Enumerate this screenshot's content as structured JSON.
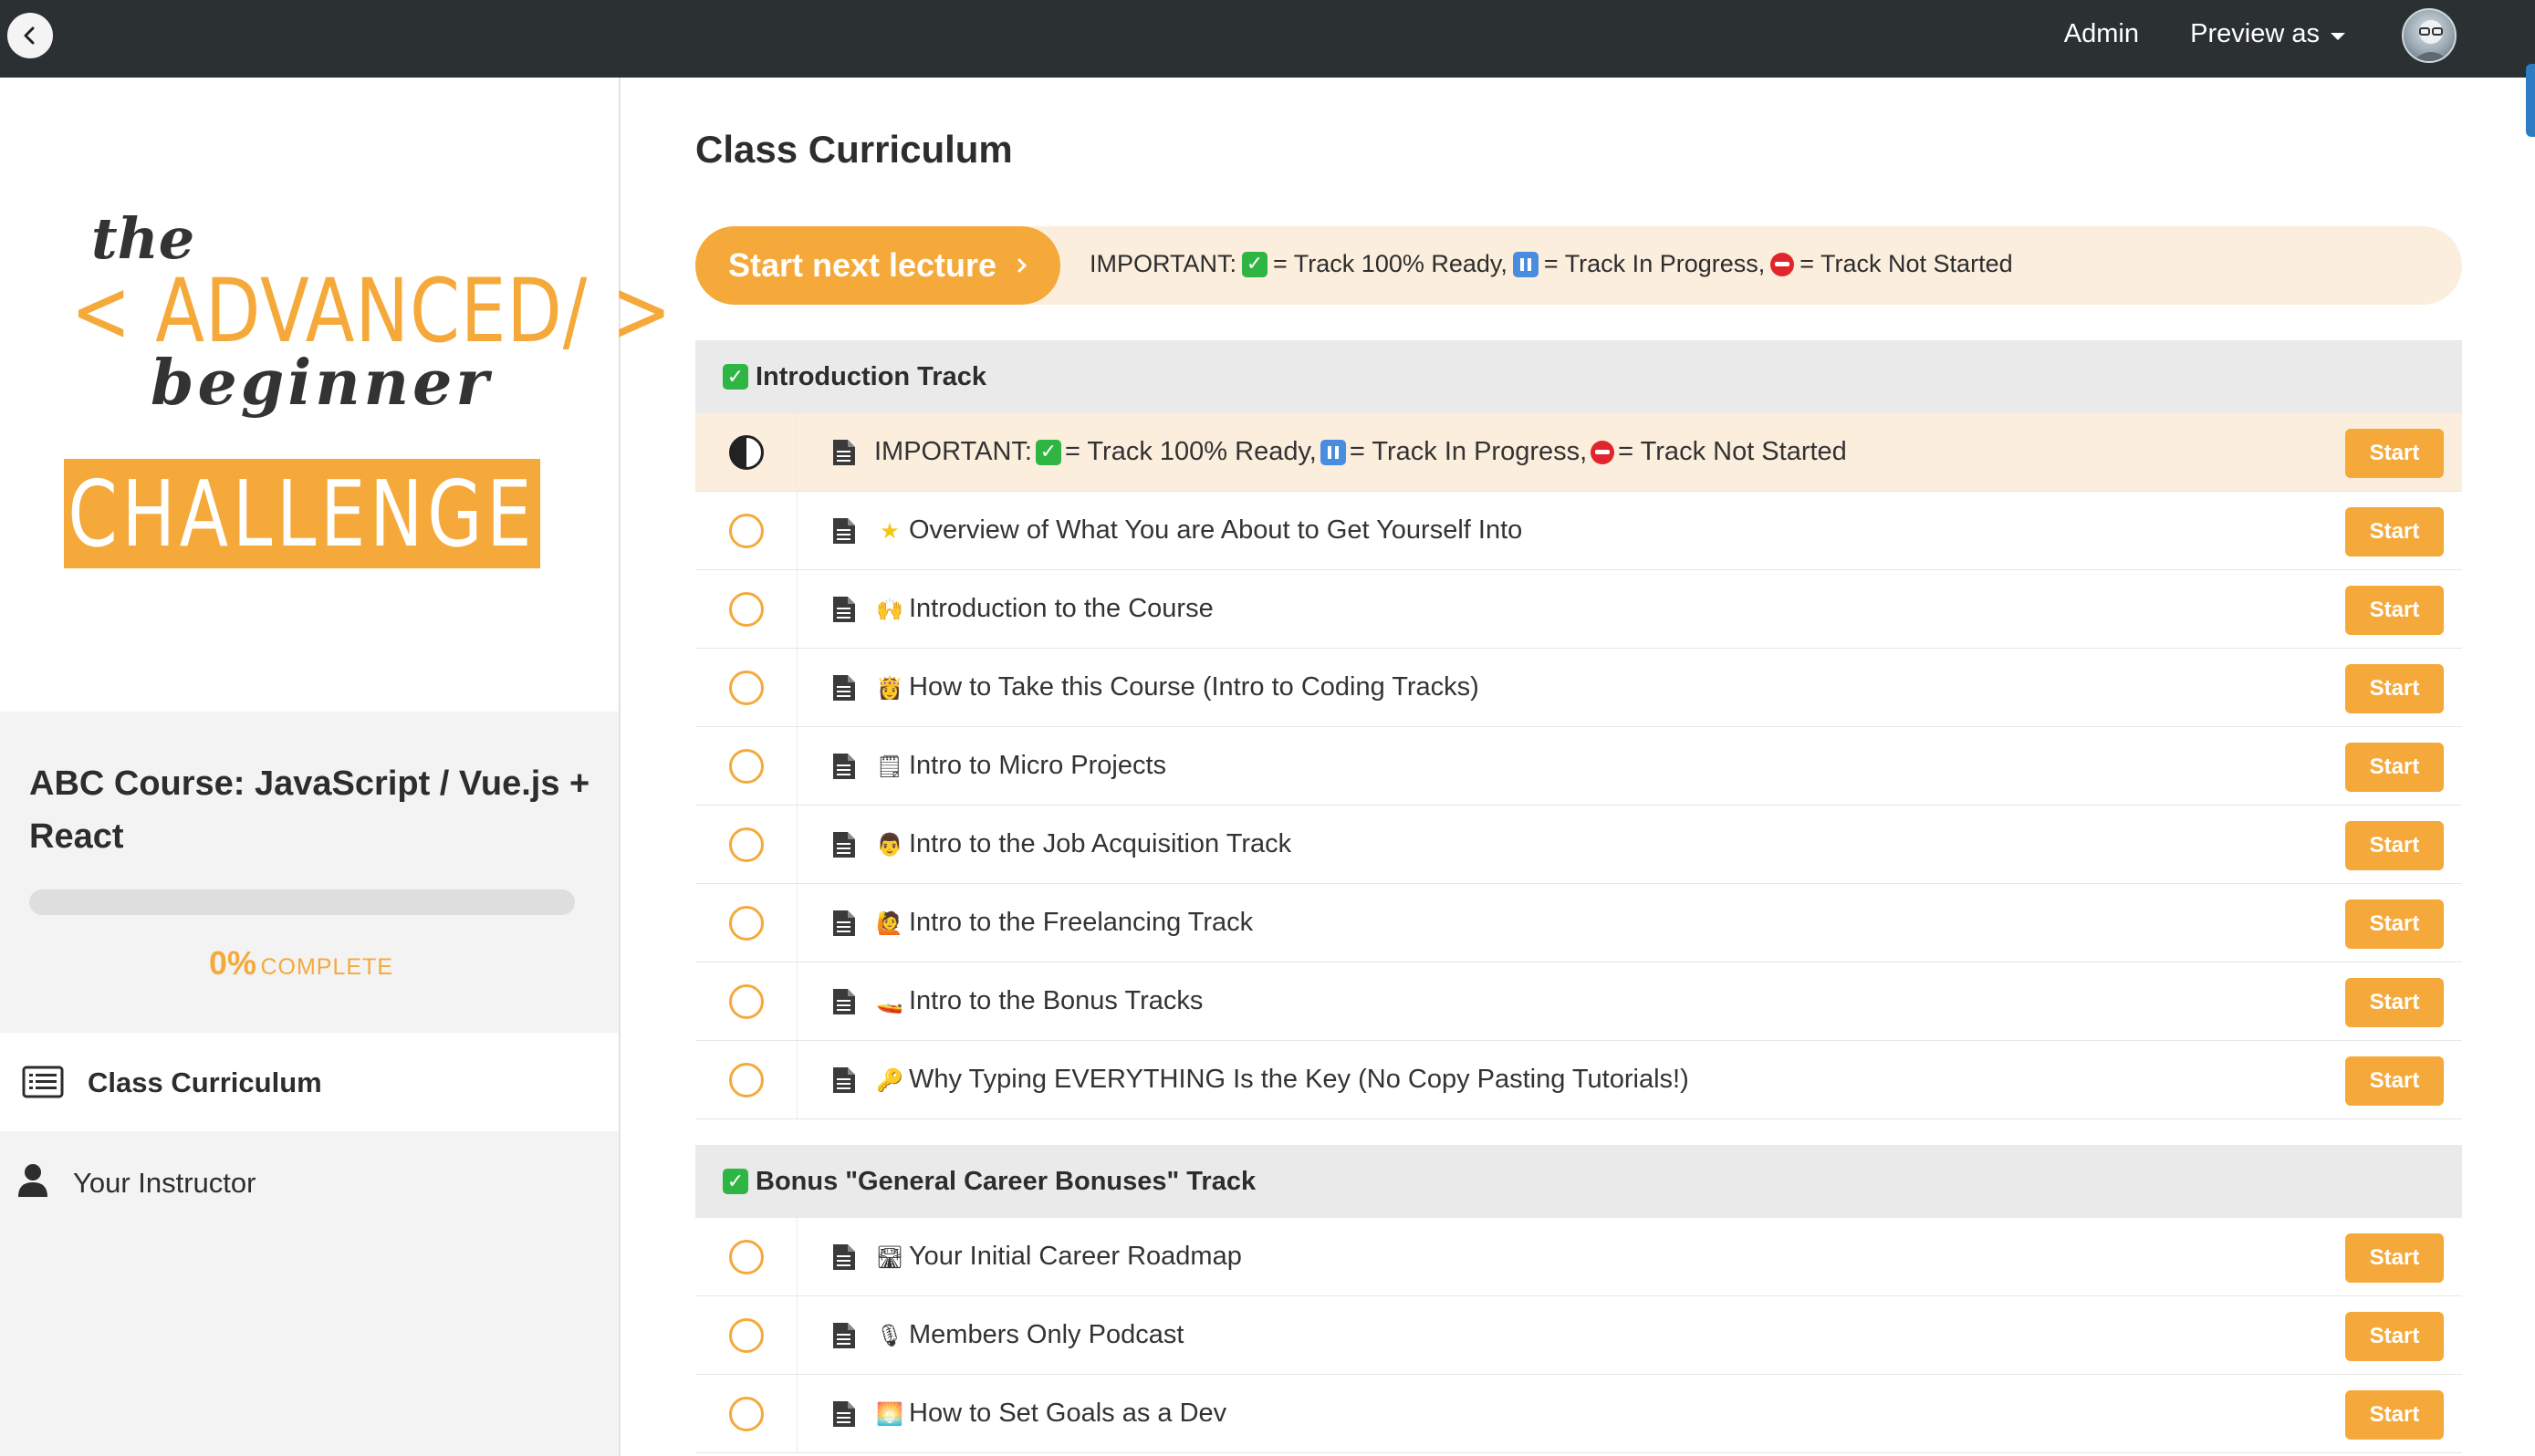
{
  "topbar": {
    "admin_label": "Admin",
    "preview_label": "Preview as"
  },
  "sidebar": {
    "logo": {
      "line1": "the",
      "line2": "< ADVANCED/ >",
      "line3": "beginner",
      "line4": "CHALLENGE"
    },
    "course_title": "ABC Course: JavaScript / Vue.js + React",
    "progress_percent": 0,
    "progress_value": "0%",
    "progress_label": "COMPLETE",
    "nav": [
      {
        "label": "Class Curriculum",
        "icon": "list-icon",
        "active": true
      },
      {
        "label": "Your Instructor",
        "icon": "user-icon",
        "active": false
      }
    ]
  },
  "main": {
    "title": "Class Curriculum",
    "start_next_label": "Start next lecture",
    "banner": {
      "prefix": "IMPORTANT:",
      "ready": "= Track 100% Ready,",
      "progress": "= Track In Progress,",
      "notstarted": "= Track Not Started"
    },
    "sections": [
      {
        "title": "Introduction Track",
        "lectures": [
          {
            "title_prefix": "IMPORTANT:",
            "title": "",
            "status": "in-progress",
            "highlight": true,
            "button": "Start"
          },
          {
            "emoji": "★",
            "title": "Overview of What You are About to Get Yourself Into",
            "status": "not-started",
            "button": "Start"
          },
          {
            "emoji": "🙌",
            "title": "Introduction to the Course",
            "status": "not-started",
            "button": "Start"
          },
          {
            "emoji": "👸",
            "title": "How to Take this Course (Intro to Coding Tracks)",
            "status": "not-started",
            "button": "Start"
          },
          {
            "emoji": "🗒",
            "title": "Intro to Micro Projects",
            "status": "not-started",
            "button": "Start"
          },
          {
            "emoji": "👨",
            "title": "Intro to the Job Acquisition Track",
            "status": "not-started",
            "button": "Start"
          },
          {
            "emoji": "🙋",
            "title": "Intro to the Freelancing Track",
            "status": "not-started",
            "button": "Start"
          },
          {
            "emoji": "🚤",
            "title": "Intro to the Bonus Tracks",
            "status": "not-started",
            "button": "Start"
          },
          {
            "emoji": "🔑",
            "title": "Why Typing EVERYTHING Is the Key (No Copy Pasting Tutorials!)",
            "status": "not-started",
            "button": "Start"
          }
        ]
      },
      {
        "title": "Bonus \"General Career Bonuses\" Track",
        "lectures": [
          {
            "emoji": "🛣",
            "title": "Your Initial Career Roadmap",
            "status": "not-started",
            "button": "Start"
          },
          {
            "emoji": "🎙",
            "title": "Members Only Podcast",
            "status": "not-started",
            "button": "Start"
          },
          {
            "emoji": "🌅",
            "title": "How to Set Goals as a Dev",
            "status": "not-started",
            "button": "Start"
          }
        ]
      }
    ]
  },
  "colors": {
    "accent": "#f5a93a",
    "topbar": "#2b3033",
    "highlight": "#fbeedd",
    "check": "#2fb543",
    "pause": "#4a8ce0",
    "stop": "#e0262c"
  }
}
